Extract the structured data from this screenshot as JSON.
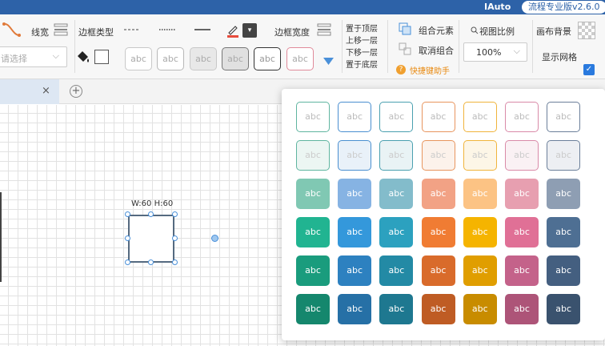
{
  "titlebar": {
    "app_name": "IAuto",
    "version": "流程专业版v2.6.0"
  },
  "toolbar": {
    "line_width_label": "线宽",
    "border_type_label": "边框类型",
    "border_width_label": "边框宽度",
    "select_placeholder": "请选择",
    "sample_text": "abc",
    "layer_menu": [
      "置于顶层",
      "上移一层",
      "下移一层",
      "置于底层"
    ],
    "group_label": "组合元素",
    "ungroup_label": "取消组合",
    "shortcut_help": "快捷键助手",
    "zoom_label": "视图比例",
    "zoom_value": "100%",
    "canvas_bg_label": "画布背景",
    "show_grid_label": "显示网格",
    "show_grid_checked": true
  },
  "tab": {
    "close_glyph": "×",
    "add_glyph": "+"
  },
  "canvas": {
    "shape_dimensions": "W:60 H:60"
  },
  "style_popup": {
    "sample_text": "abc",
    "rows": [
      {
        "style": "outline",
        "colors": [
          "#5fb5a0",
          "#4a8fd0",
          "#4aa0b0",
          "#e8955e",
          "#f0b43c",
          "#d98aa8",
          "#6b7f9a"
        ]
      },
      {
        "style": "light",
        "colors": [
          "#5fb5a0",
          "#4a8fd0",
          "#4aa0b0",
          "#e8955e",
          "#f0b43c",
          "#d98aa8",
          "#6b7f9a"
        ]
      },
      {
        "style": "medium",
        "colors": [
          "#80c8b3",
          "#86b3e3",
          "#83bccb",
          "#f2a285",
          "#fcc384",
          "#e79fb0",
          "#8e9eb3"
        ]
      },
      {
        "style": "solid",
        "colors": [
          "#21b491",
          "#3498db",
          "#2ca1bf",
          "#f07c33",
          "#f5b400",
          "#e07096",
          "#4e6f93"
        ]
      },
      {
        "style": "solid",
        "colors": [
          "#1a9c7d",
          "#2d81c0",
          "#238aa5",
          "#d96b2b",
          "#e09e00",
          "#c4628a",
          "#445f80"
        ]
      },
      {
        "style": "solid",
        "colors": [
          "#15876d",
          "#2670a6",
          "#1e7890",
          "#bf5c24",
          "#c88c00",
          "#ad5478",
          "#3a526e"
        ]
      }
    ]
  }
}
